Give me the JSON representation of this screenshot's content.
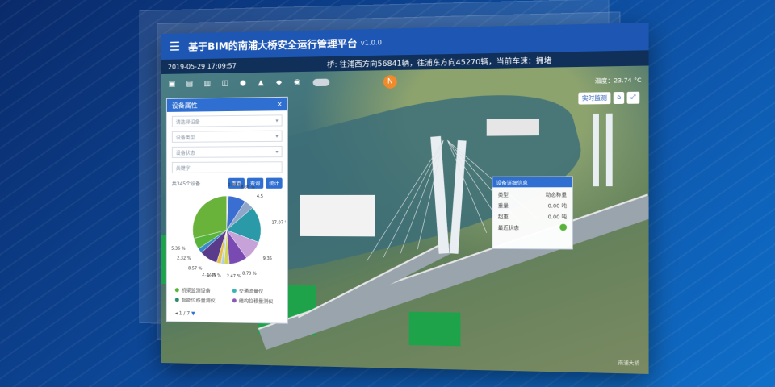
{
  "app": {
    "title": "基于BIM的南浦大桥安全运行管理平台",
    "version": "v1.0.0"
  },
  "infobar": {
    "datetime": "2019-05-29 17:09:57",
    "traffic": "桥: 往浦西方向56841辆，往浦东方向45270辆，当前车速：拥堵"
  },
  "weather": "温度：23.74 °C",
  "right_tools": [
    "实时监测"
  ],
  "panel": {
    "title": "设备属性",
    "filters": [
      "请选择设备",
      "设备类型",
      "设备状态",
      "关键字"
    ],
    "count_label": "共345个设备",
    "buttons": [
      "重置",
      "查询",
      "统计"
    ],
    "pager": "1 / 7",
    "legend": [
      {
        "label": "桥梁监测设备",
        "color": "#57b33a"
      },
      {
        "label": "交通流量仪",
        "color": "#3bb3b3"
      },
      {
        "label": "智能位移量测仪",
        "color": "#2a8a6a"
      },
      {
        "label": "结构位移量测仪",
        "color": "#8a5ab3"
      }
    ]
  },
  "chart_data": {
    "type": "pie",
    "slices": [
      {
        "value": 0.8,
        "label": "0.80 %",
        "color": "#e6e6e6"
      },
      {
        "value": 8.38,
        "label": "8.38 %",
        "color": "#3b6ed1"
      },
      {
        "value": 4.5,
        "label": "4.5",
        "color": "#8fa6c9"
      },
      {
        "value": 17.07,
        "label": "17.07 %",
        "color": "#2a9aa8"
      },
      {
        "value": 9.35,
        "label": "9.35",
        "color": "#c7a2d9"
      },
      {
        "value": 8.7,
        "label": "8.70 %",
        "color": "#7a4ab3"
      },
      {
        "value": 2.47,
        "label": "2.47 %",
        "color": "#d1d65a"
      },
      {
        "value": 1.45,
        "label": "1.45 %",
        "color": "#b3d1e6"
      },
      {
        "value": 2.12,
        "label": "2.12 %",
        "color": "#e6c14a"
      },
      {
        "value": 8.57,
        "label": "8.57 %",
        "color": "#5a3a8a"
      },
      {
        "value": 2.32,
        "label": "2.32 %",
        "color": "#3a8ac9"
      },
      {
        "value": 5.36,
        "label": "5.36 %",
        "color": "#57b33a"
      },
      {
        "value": 29.0,
        "label": "",
        "color": "#6ab33a"
      }
    ]
  },
  "popup": {
    "title": "设备详细信息",
    "rows": [
      {
        "k": "类型",
        "v": "动态称重"
      },
      {
        "k": "重量",
        "v": "0.00 吨"
      },
      {
        "k": "超重",
        "v": "0.00 吨"
      },
      {
        "k": "最近状态",
        "v": ""
      }
    ]
  },
  "watermark": "南浦大桥"
}
